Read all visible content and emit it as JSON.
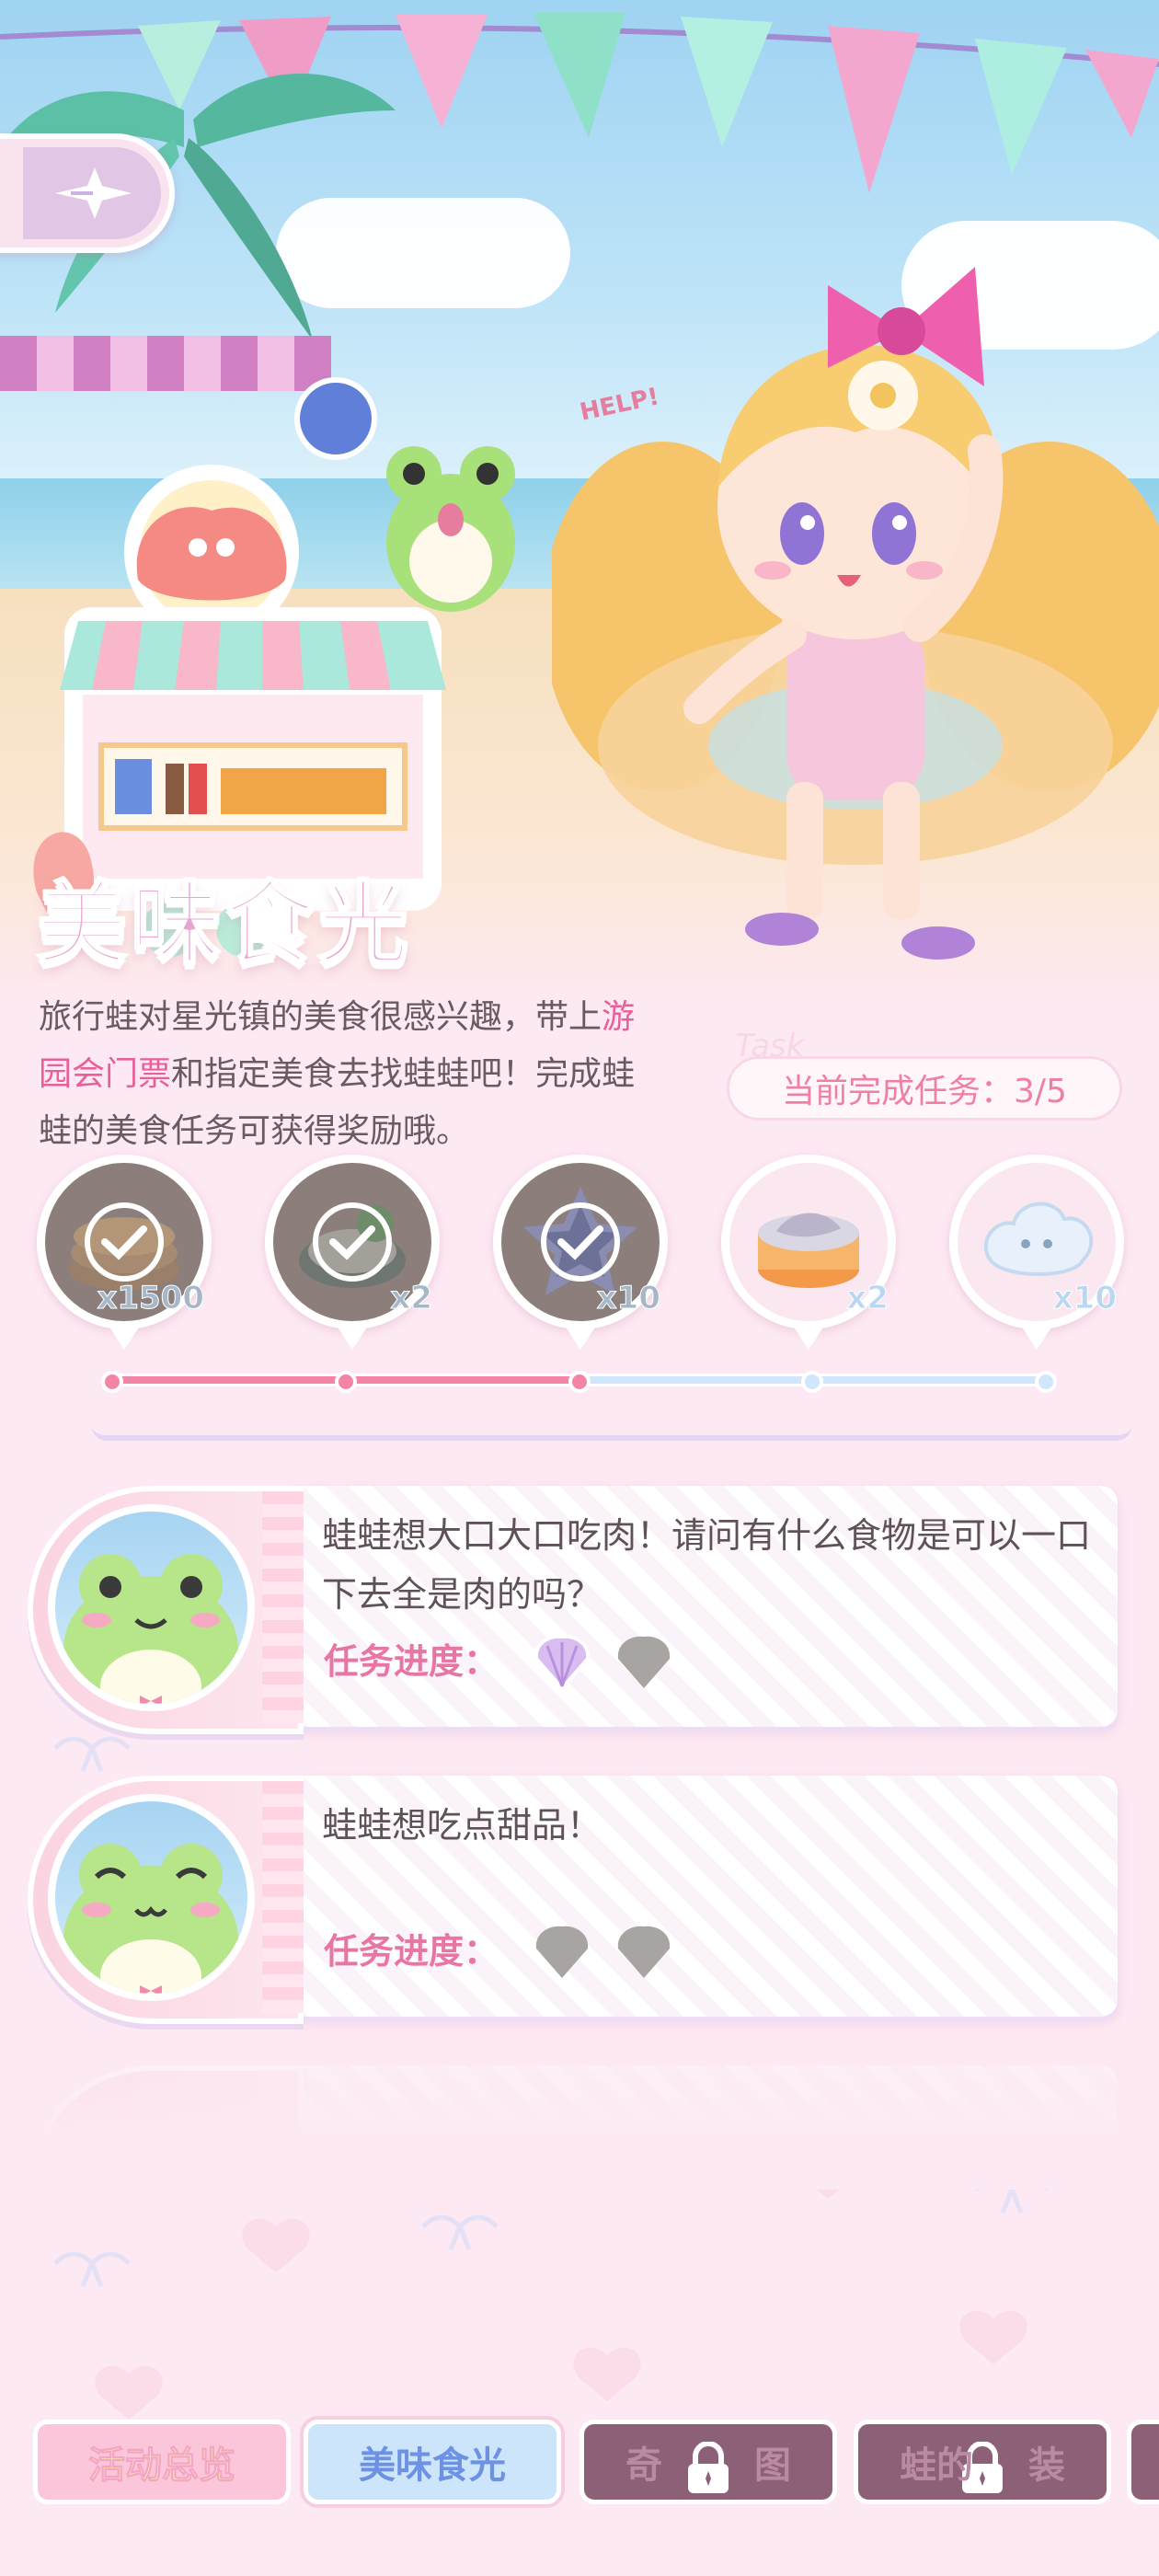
{
  "event": {
    "title": "美味食光",
    "description_parts": [
      "旅行蛙对星光镇的美食很感兴趣，带上",
      "游园会门票",
      "和指定美食去找蛙蛙吧！完成蛙蛙的美食任务可获得奖励哦。"
    ],
    "task_status": "当前完成任务：3/5",
    "task_ghost": "Task",
    "help_sign": "HELP!"
  },
  "rewards": [
    {
      "name": "coins",
      "qty": "x1500",
      "claimed": true
    },
    {
      "name": "dumplings",
      "qty": "x2",
      "claimed": true
    },
    {
      "name": "star-gem",
      "qty": "x10",
      "claimed": true
    },
    {
      "name": "canned-food",
      "qty": "x2",
      "claimed": false
    },
    {
      "name": "cloud-puff",
      "qty": "x10",
      "claimed": false
    }
  ],
  "progress": {
    "completed": 3,
    "total": 5
  },
  "missions": [
    {
      "text": "蛙蛙想大口大口吃肉！请问有什么食物是可以一口下去全是肉的吗？",
      "progress_label": "任务进度：",
      "shells": [
        true,
        false
      ]
    },
    {
      "text": "蛙蛙想吃点甜品！",
      "progress_label": "任务进度：",
      "shells": [
        false,
        false
      ]
    }
  ],
  "tabs": [
    {
      "label": "活动总览",
      "state": "normal"
    },
    {
      "label": "美味食光",
      "state": "active"
    },
    {
      "label": "奇",
      "label_tail": "图",
      "state": "locked"
    },
    {
      "label": "蛙的",
      "label_tail": "装",
      "state": "locked"
    }
  ],
  "colors": {
    "accent_pink": "#e8609a",
    "progress_fill": "#f483a8",
    "progress_track": "#cfe6fb"
  }
}
